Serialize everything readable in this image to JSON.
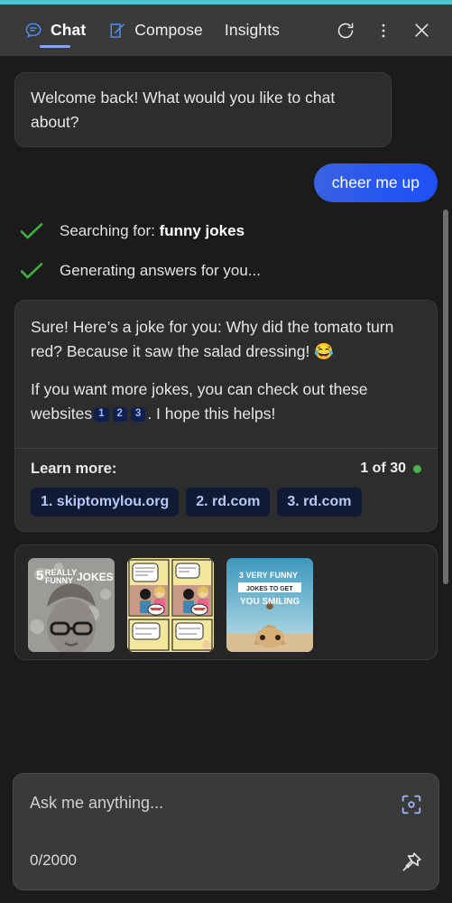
{
  "theme": {
    "accent_bar_color": "#4ec3cd",
    "header_bg": "#3a3a3a",
    "page_bg": "#1b1b1b",
    "bubble_bot_bg": "#2d2d2d",
    "bubble_user_gradient_from": "#3a63e0",
    "bubble_user_gradient_to": "#1f4ff5",
    "check_color": "#43b043",
    "status_dot_color": "#4caf50",
    "citation_bg": "#10204d",
    "citation_text": "#9db6f5",
    "chip_bg": "#101a35",
    "chip_text": "#b7c8f4",
    "tab_underline": "#8aa4ee"
  },
  "header": {
    "tabs": [
      {
        "label": "Chat",
        "icon": "chat-bubble-icon",
        "active": true
      },
      {
        "label": "Compose",
        "icon": "compose-pencil-icon",
        "active": false
      },
      {
        "label": "Insights",
        "icon": null,
        "active": false
      }
    ],
    "actions": [
      {
        "name": "refresh-icon",
        "label": "Refresh"
      },
      {
        "name": "more-options-icon",
        "label": "More options"
      },
      {
        "name": "close-icon",
        "label": "Close"
      }
    ]
  },
  "conversation": {
    "greeting": "Welcome back! What would you like to chat about?",
    "user_message": "cheer me up",
    "status_steps": [
      {
        "prefix": "Searching for: ",
        "emphasis": "funny jokes",
        "icon": "check-icon"
      },
      {
        "prefix": "Generating answers for you...",
        "emphasis": "",
        "icon": "check-icon"
      }
    ],
    "answer": {
      "paragraph_1": "Sure! Here’s a joke for you: Why did the tomato turn red? Because it saw the salad dressing! 😂",
      "paragraph_2_before": "If you want more jokes, you can check out these websites",
      "paragraph_2_after": ". I hope this helps!",
      "citations": [
        "1",
        "2",
        "3"
      ],
      "learn_more_label": "Learn more:",
      "result_count": "1 of 30",
      "links": [
        "1. skiptomylou.org",
        "2. rd.com",
        "3. rd.com"
      ]
    },
    "image_results": [
      {
        "name": "thumbnail-5-really-funny-jokes",
        "caption": "5 REALLY FUNNY JOKES"
      },
      {
        "name": "thumbnail-comic-strip",
        "caption": ""
      },
      {
        "name": "thumbnail-3-very-funny-jokes",
        "caption": "3 VERY FUNNY JOKES TO GET YOU SMILING"
      }
    ]
  },
  "composer": {
    "placeholder": "Ask me anything...",
    "counter": "0/2000",
    "visual_search_icon": "visual-search-icon",
    "pin_icon": "pin-icon"
  }
}
